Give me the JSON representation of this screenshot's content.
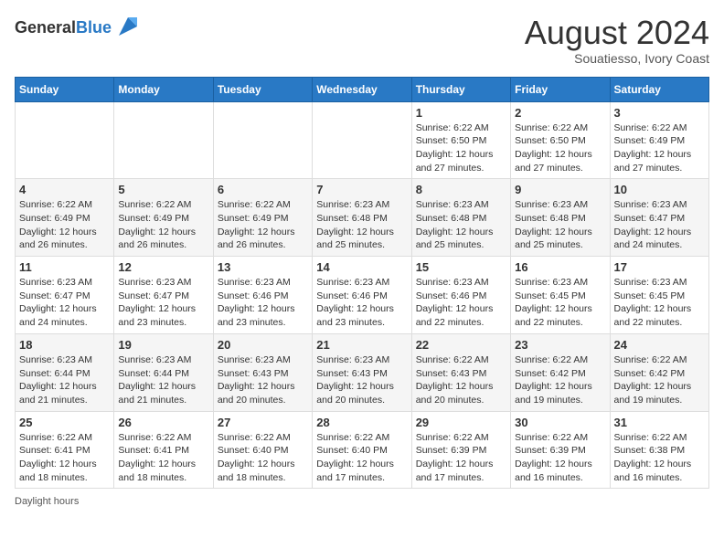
{
  "logo": {
    "line1": "General",
    "line2": "Blue"
  },
  "title": "August 2024",
  "subtitle": "Souatiesso, Ivory Coast",
  "days_of_week": [
    "Sunday",
    "Monday",
    "Tuesday",
    "Wednesday",
    "Thursday",
    "Friday",
    "Saturday"
  ],
  "footer": "Daylight hours",
  "weeks": [
    [
      {
        "day": "",
        "info": ""
      },
      {
        "day": "",
        "info": ""
      },
      {
        "day": "",
        "info": ""
      },
      {
        "day": "",
        "info": ""
      },
      {
        "day": "1",
        "info": "Sunrise: 6:22 AM\nSunset: 6:50 PM\nDaylight: 12 hours and 27 minutes."
      },
      {
        "day": "2",
        "info": "Sunrise: 6:22 AM\nSunset: 6:50 PM\nDaylight: 12 hours and 27 minutes."
      },
      {
        "day": "3",
        "info": "Sunrise: 6:22 AM\nSunset: 6:49 PM\nDaylight: 12 hours and 27 minutes."
      }
    ],
    [
      {
        "day": "4",
        "info": "Sunrise: 6:22 AM\nSunset: 6:49 PM\nDaylight: 12 hours and 26 minutes."
      },
      {
        "day": "5",
        "info": "Sunrise: 6:22 AM\nSunset: 6:49 PM\nDaylight: 12 hours and 26 minutes."
      },
      {
        "day": "6",
        "info": "Sunrise: 6:22 AM\nSunset: 6:49 PM\nDaylight: 12 hours and 26 minutes."
      },
      {
        "day": "7",
        "info": "Sunrise: 6:23 AM\nSunset: 6:48 PM\nDaylight: 12 hours and 25 minutes."
      },
      {
        "day": "8",
        "info": "Sunrise: 6:23 AM\nSunset: 6:48 PM\nDaylight: 12 hours and 25 minutes."
      },
      {
        "day": "9",
        "info": "Sunrise: 6:23 AM\nSunset: 6:48 PM\nDaylight: 12 hours and 25 minutes."
      },
      {
        "day": "10",
        "info": "Sunrise: 6:23 AM\nSunset: 6:47 PM\nDaylight: 12 hours and 24 minutes."
      }
    ],
    [
      {
        "day": "11",
        "info": "Sunrise: 6:23 AM\nSunset: 6:47 PM\nDaylight: 12 hours and 24 minutes."
      },
      {
        "day": "12",
        "info": "Sunrise: 6:23 AM\nSunset: 6:47 PM\nDaylight: 12 hours and 23 minutes."
      },
      {
        "day": "13",
        "info": "Sunrise: 6:23 AM\nSunset: 6:46 PM\nDaylight: 12 hours and 23 minutes."
      },
      {
        "day": "14",
        "info": "Sunrise: 6:23 AM\nSunset: 6:46 PM\nDaylight: 12 hours and 23 minutes."
      },
      {
        "day": "15",
        "info": "Sunrise: 6:23 AM\nSunset: 6:46 PM\nDaylight: 12 hours and 22 minutes."
      },
      {
        "day": "16",
        "info": "Sunrise: 6:23 AM\nSunset: 6:45 PM\nDaylight: 12 hours and 22 minutes."
      },
      {
        "day": "17",
        "info": "Sunrise: 6:23 AM\nSunset: 6:45 PM\nDaylight: 12 hours and 22 minutes."
      }
    ],
    [
      {
        "day": "18",
        "info": "Sunrise: 6:23 AM\nSunset: 6:44 PM\nDaylight: 12 hours and 21 minutes."
      },
      {
        "day": "19",
        "info": "Sunrise: 6:23 AM\nSunset: 6:44 PM\nDaylight: 12 hours and 21 minutes."
      },
      {
        "day": "20",
        "info": "Sunrise: 6:23 AM\nSunset: 6:43 PM\nDaylight: 12 hours and 20 minutes."
      },
      {
        "day": "21",
        "info": "Sunrise: 6:23 AM\nSunset: 6:43 PM\nDaylight: 12 hours and 20 minutes."
      },
      {
        "day": "22",
        "info": "Sunrise: 6:22 AM\nSunset: 6:43 PM\nDaylight: 12 hours and 20 minutes."
      },
      {
        "day": "23",
        "info": "Sunrise: 6:22 AM\nSunset: 6:42 PM\nDaylight: 12 hours and 19 minutes."
      },
      {
        "day": "24",
        "info": "Sunrise: 6:22 AM\nSunset: 6:42 PM\nDaylight: 12 hours and 19 minutes."
      }
    ],
    [
      {
        "day": "25",
        "info": "Sunrise: 6:22 AM\nSunset: 6:41 PM\nDaylight: 12 hours and 18 minutes."
      },
      {
        "day": "26",
        "info": "Sunrise: 6:22 AM\nSunset: 6:41 PM\nDaylight: 12 hours and 18 minutes."
      },
      {
        "day": "27",
        "info": "Sunrise: 6:22 AM\nSunset: 6:40 PM\nDaylight: 12 hours and 18 minutes."
      },
      {
        "day": "28",
        "info": "Sunrise: 6:22 AM\nSunset: 6:40 PM\nDaylight: 12 hours and 17 minutes."
      },
      {
        "day": "29",
        "info": "Sunrise: 6:22 AM\nSunset: 6:39 PM\nDaylight: 12 hours and 17 minutes."
      },
      {
        "day": "30",
        "info": "Sunrise: 6:22 AM\nSunset: 6:39 PM\nDaylight: 12 hours and 16 minutes."
      },
      {
        "day": "31",
        "info": "Sunrise: 6:22 AM\nSunset: 6:38 PM\nDaylight: 12 hours and 16 minutes."
      }
    ]
  ]
}
